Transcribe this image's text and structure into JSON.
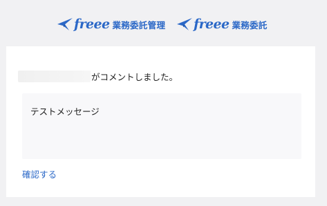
{
  "header": {
    "brands": [
      {
        "wordmark": "freee",
        "product": "業務委託管理"
      },
      {
        "wordmark": "freee",
        "product": "業務委託"
      }
    ]
  },
  "notification": {
    "actor_name": "",
    "action_text": "がコメントしました。",
    "message": "テストメッセージ",
    "confirm_label": "確認する"
  },
  "colors": {
    "brand_blue": "#2b68c7",
    "page_background": "#f1f1f3",
    "card_background": "#ffffff",
    "message_background": "#f8f8fa"
  }
}
